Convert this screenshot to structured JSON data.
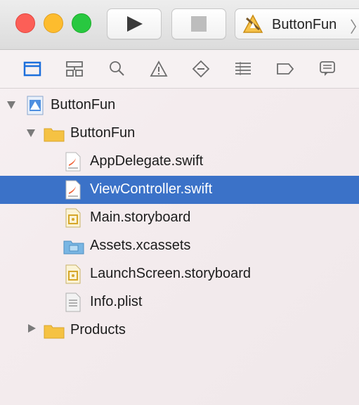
{
  "toolbar": {
    "scheme_label": "ButtonFun",
    "scheme_chevron": "〉"
  },
  "navigator_tabs": [
    {
      "icon": "folder-icon"
    },
    {
      "icon": "hierarchy-icon"
    },
    {
      "icon": "search-icon"
    },
    {
      "icon": "warning-icon"
    },
    {
      "icon": "test-diamond-icon"
    },
    {
      "icon": "debug-lines-icon"
    },
    {
      "icon": "breakpoint-tag-icon"
    },
    {
      "icon": "report-bubble-icon"
    }
  ],
  "tree": {
    "project": {
      "label": "ButtonFun",
      "icon": "xcode-project-icon"
    },
    "group": {
      "label": "ButtonFun",
      "icon": "yellow-folder-icon"
    },
    "files": [
      {
        "label": "AppDelegate.swift",
        "icon": "swift-file-icon",
        "selected": false
      },
      {
        "label": "ViewController.swift",
        "icon": "swift-file-icon",
        "selected": true
      },
      {
        "label": "Main.storyboard",
        "icon": "storyboard-file-icon",
        "selected": false
      },
      {
        "label": "Assets.xcassets",
        "icon": "asset-catalog-icon",
        "selected": false
      },
      {
        "label": "LaunchScreen.storyboard",
        "icon": "storyboard-file-icon",
        "selected": false
      },
      {
        "label": "Info.plist",
        "icon": "plist-file-icon",
        "selected": false
      }
    ],
    "products": {
      "label": "Products",
      "icon": "yellow-folder-icon"
    }
  },
  "colors": {
    "selection": "#3b72c8",
    "folder_yellow": "#f5c243",
    "swift_orange": "#f0643a",
    "nav_icon_active": "#1c6fdc",
    "nav_icon_inactive": "#6d6d6d"
  }
}
